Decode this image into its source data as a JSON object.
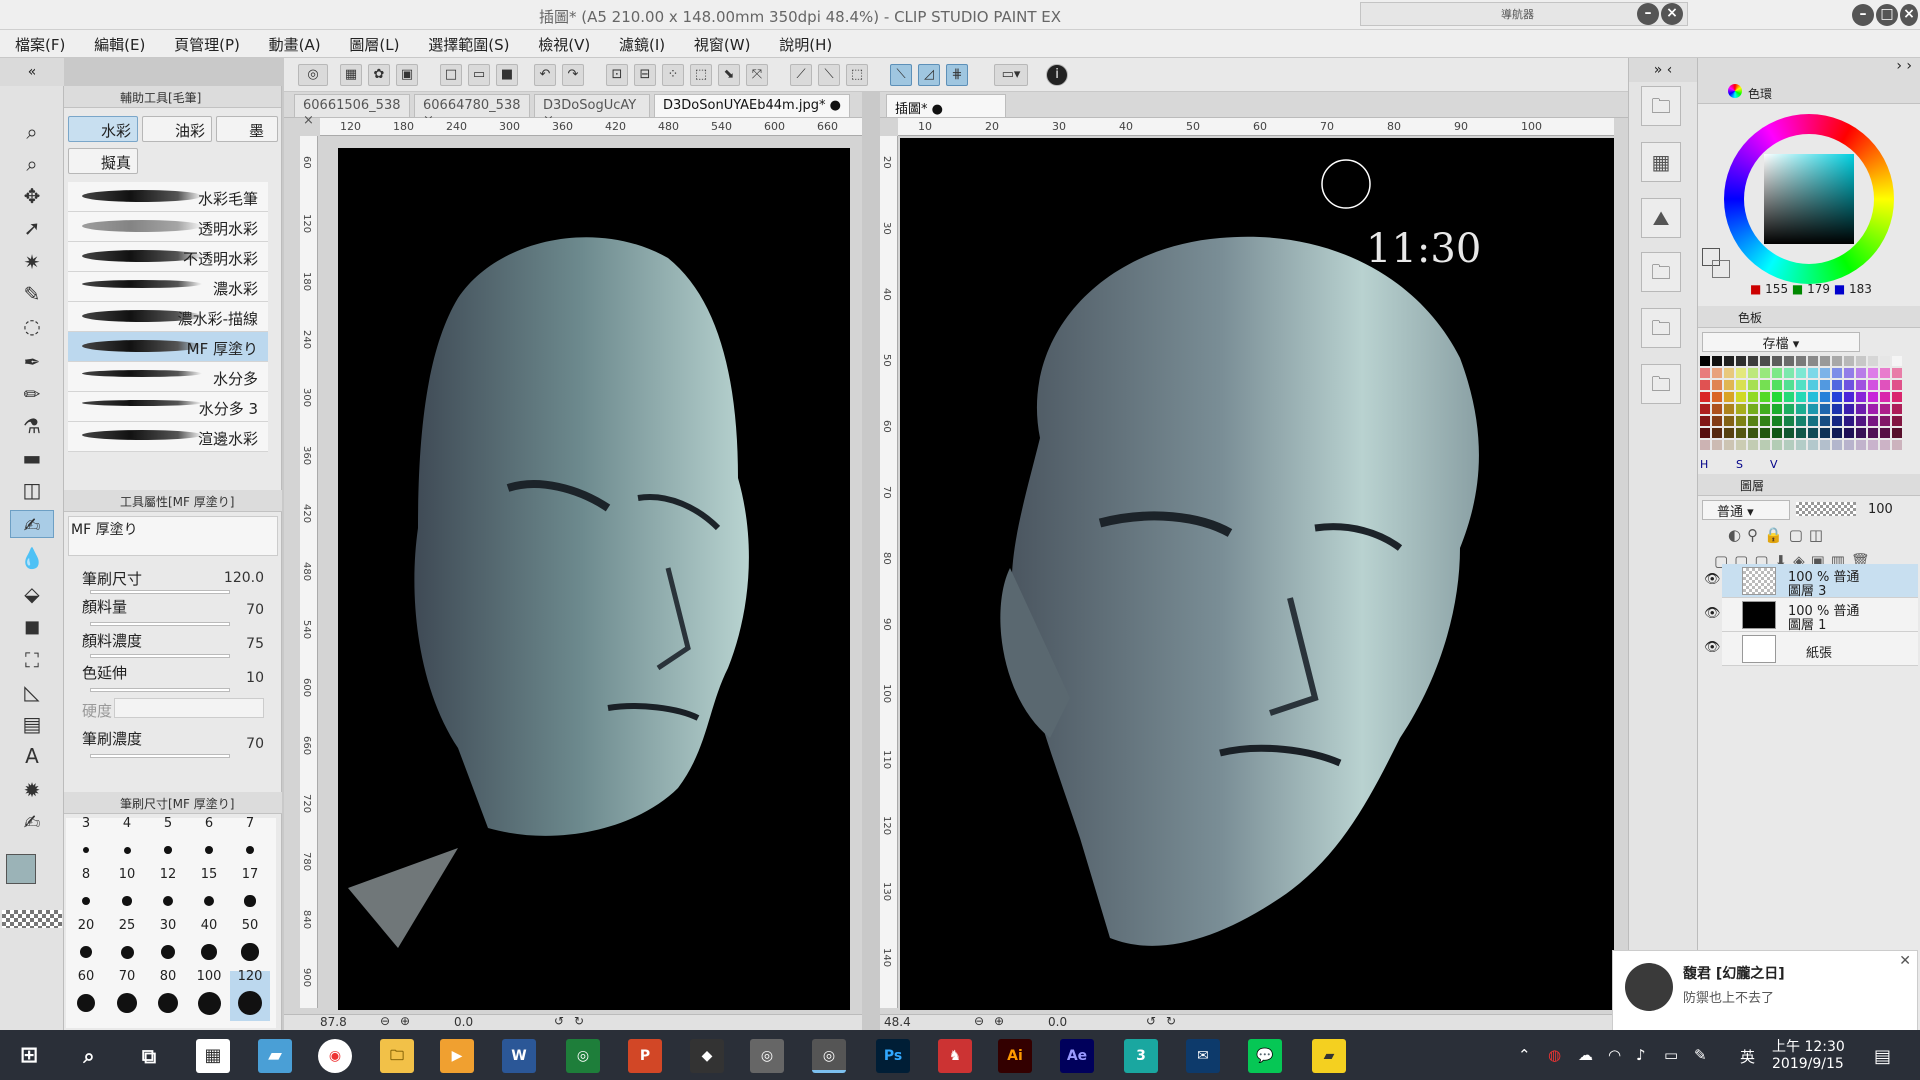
{
  "window": {
    "title": "插圖* (A5 210.00 x 148.00mm 350dpi 48.4%) - CLIP STUDIO PAINT EX",
    "navigator_label": "導航器"
  },
  "menu": [
    "檔案(F)",
    "編輯(E)",
    "頁管理(P)",
    "動畫(A)",
    "圖層(L)",
    "選擇範圍(S)",
    "檢視(V)",
    "濾鏡(I)",
    "視窗(W)",
    "說明(H)"
  ],
  "subtool": {
    "header": "輔助工具[毛筆]",
    "tabs": [
      "水彩",
      "油彩",
      "墨",
      "擬真"
    ],
    "brushes": [
      "水彩毛筆",
      "透明水彩",
      "不透明水彩",
      "濃水彩",
      "濃水彩-描線",
      "MF 厚塗り",
      "水分多",
      "水分多 3",
      "渲邊水彩"
    ],
    "selected_brush": "MF 厚塗り"
  },
  "toolprops": {
    "header": "工具屬性[MF 厚塗り]",
    "brush_name": "MF 厚塗り",
    "props": [
      {
        "label": "筆刷尺寸",
        "value": "120.0"
      },
      {
        "label": "顏料量",
        "value": "70"
      },
      {
        "label": "顏料濃度",
        "value": "75"
      },
      {
        "label": "色延伸",
        "value": "10"
      },
      {
        "label": "硬度",
        "value": ""
      },
      {
        "label": "筆刷濃度",
        "value": "70"
      }
    ]
  },
  "brushsize": {
    "header": "筆刷尺寸[MF 厚塗り]",
    "sizes": [
      "3",
      "4",
      "5",
      "6",
      "7",
      "8",
      "10",
      "12",
      "15",
      "17",
      "20",
      "25",
      "30",
      "40",
      "50",
      "60",
      "70",
      "80",
      "100",
      "120"
    ],
    "selected": "120"
  },
  "documents": {
    "left_tabs": [
      "60661506_538",
      "60664780_538",
      "D3DoSogUcAY",
      "D3DoSonUYAEb44m.jpg*"
    ],
    "right_tabs": [
      "插圖*"
    ],
    "left_zoom": "87.8",
    "left_angle": "0.0",
    "right_zoom": "48.4",
    "right_angle": "0.0",
    "left_ruler": [
      "120",
      "180",
      "240",
      "300",
      "360",
      "420",
      "480",
      "540",
      "600",
      "660"
    ],
    "left_vruler": [
      "60",
      "120",
      "180",
      "240",
      "300",
      "360",
      "420",
      "480",
      "540",
      "600",
      "660",
      "720",
      "780",
      "840",
      "900"
    ],
    "right_ruler": [
      "10",
      "20",
      "30",
      "40",
      "50",
      "60",
      "70",
      "80",
      "90",
      "100"
    ],
    "right_vruler": [
      "20",
      "30",
      "40",
      "50",
      "60",
      "70",
      "80",
      "90",
      "100",
      "110",
      "120",
      "130",
      "140"
    ],
    "canvas_note": "11:30"
  },
  "color": {
    "panel_label": "色環",
    "r": "155",
    "g": "179",
    "b": "183",
    "main_color": "#9bb3b7",
    "sub_color": "#f8d49c",
    "palette_label": "色板",
    "palette_name": "存檔",
    "hsv": [
      "H",
      "S",
      "V"
    ]
  },
  "layers": {
    "panel_label": "圖層",
    "blend_mode": "普通",
    "opacity": "100",
    "items": [
      {
        "line1": "100 % 普通",
        "line2": "圖層 3"
      },
      {
        "line1": "100 % 普通",
        "line2": "圖層 1"
      },
      {
        "line1": "",
        "line2": "紙張"
      }
    ]
  },
  "notification": {
    "name": "馥君 [幻朧之日]",
    "message": "防禦也上不去了"
  },
  "taskbar": {
    "apps": [
      "Ps",
      "Ai",
      "Ae",
      "3"
    ],
    "ime": "英",
    "time": "上午 12:30",
    "date": "2019/9/15"
  }
}
